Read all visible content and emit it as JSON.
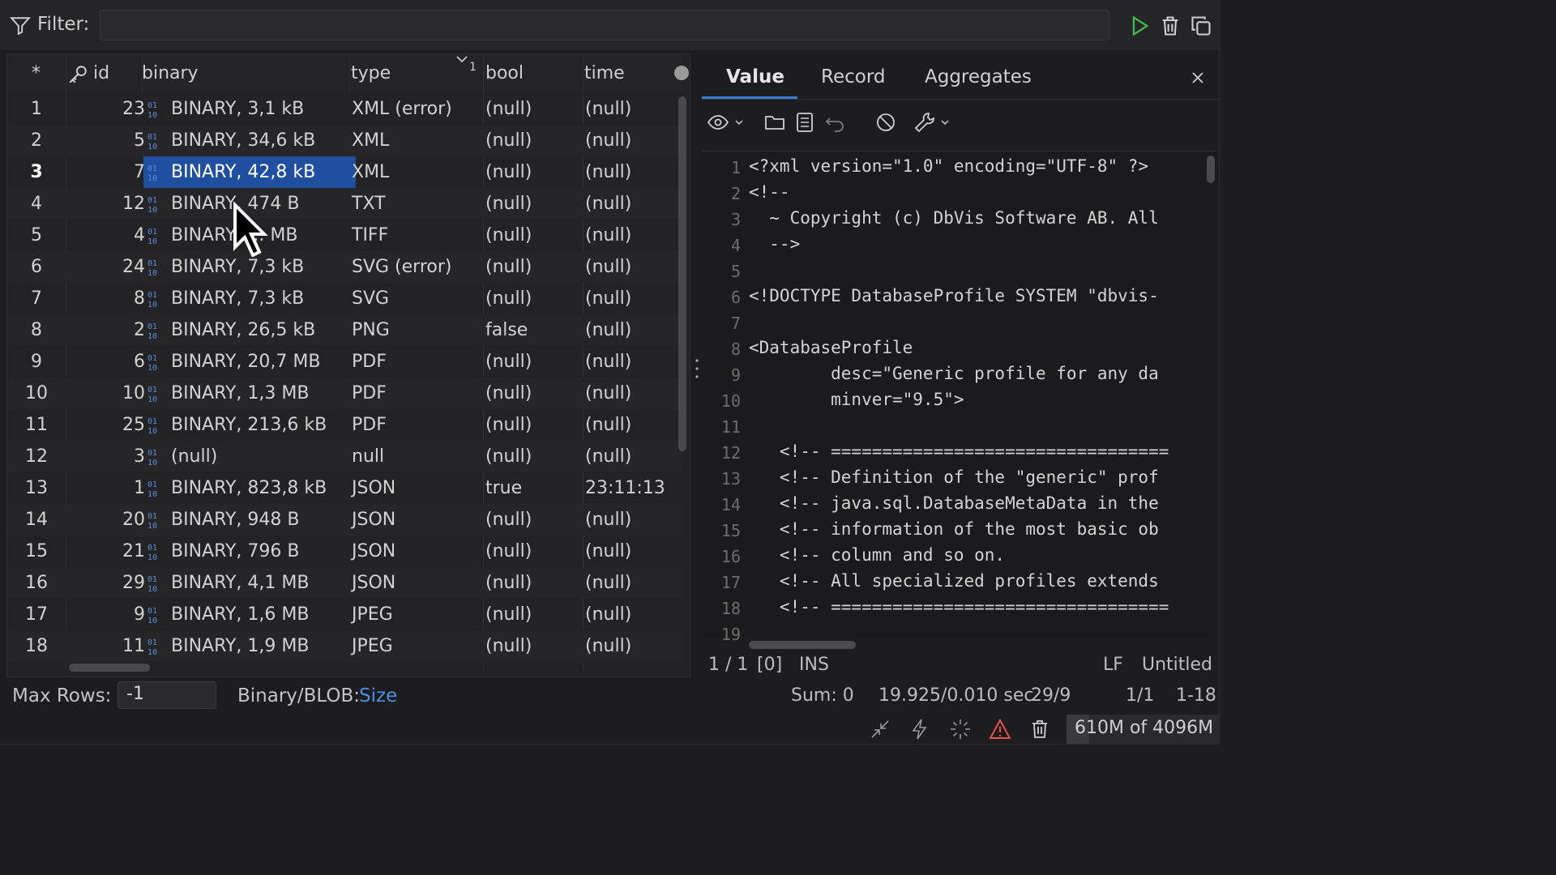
{
  "filter": {
    "label": "Filter:",
    "value": ""
  },
  "grid": {
    "columns": {
      "rownum": "*",
      "id": "id",
      "binary": "binary",
      "type": "type",
      "sort_index": "1",
      "bool": "bool",
      "time": "time"
    },
    "rows": [
      {
        "n": "1",
        "id": "23",
        "binary": "BINARY, 3,1 kB",
        "type": "XML (error)",
        "bool": "(null)",
        "time": "(null)"
      },
      {
        "n": "2",
        "id": "5",
        "binary": "BINARY, 34,6 kB",
        "type": "XML",
        "bool": "(null)",
        "time": "(null)"
      },
      {
        "n": "3",
        "id": "7",
        "binary": "BINARY, 42,8 kB",
        "type": "XML",
        "bool": "(null)",
        "time": "(null)"
      },
      {
        "n": "4",
        "id": "12",
        "binary": "BINARY, 474 B",
        "type": "TXT",
        "bool": "(null)",
        "time": "(null)"
      },
      {
        "n": "5",
        "id": "4",
        "binary": "BINARY, ... MB",
        "type": "TIFF",
        "bool": "(null)",
        "time": "(null)"
      },
      {
        "n": "6",
        "id": "24",
        "binary": "BINARY, 7,3 kB",
        "type": "SVG (error)",
        "bool": "(null)",
        "time": "(null)"
      },
      {
        "n": "7",
        "id": "8",
        "binary": "BINARY, 7,3 kB",
        "type": "SVG",
        "bool": "(null)",
        "time": "(null)"
      },
      {
        "n": "8",
        "id": "2",
        "binary": "BINARY, 26,5 kB",
        "type": "PNG",
        "bool": "false",
        "time": "(null)"
      },
      {
        "n": "9",
        "id": "6",
        "binary": "BINARY, 20,7 MB",
        "type": "PDF",
        "bool": "(null)",
        "time": "(null)"
      },
      {
        "n": "10",
        "id": "10",
        "binary": "BINARY, 1,3 MB",
        "type": "PDF",
        "bool": "(null)",
        "time": "(null)"
      },
      {
        "n": "11",
        "id": "25",
        "binary": "BINARY, 213,6 kB",
        "type": "PDF",
        "bool": "(null)",
        "time": "(null)"
      },
      {
        "n": "12",
        "id": "3",
        "binary": "(null)",
        "type": "null",
        "bool": "(null)",
        "time": "(null)"
      },
      {
        "n": "13",
        "id": "1",
        "binary": "BINARY, 823,8 kB",
        "type": "JSON",
        "bool": "true",
        "time": "23:11:13"
      },
      {
        "n": "14",
        "id": "20",
        "binary": "BINARY, 948 B",
        "type": "JSON",
        "bool": "(null)",
        "time": "(null)"
      },
      {
        "n": "15",
        "id": "21",
        "binary": "BINARY, 796 B",
        "type": "JSON",
        "bool": "(null)",
        "time": "(null)"
      },
      {
        "n": "16",
        "id": "29",
        "binary": "BINARY, 4,1 MB",
        "type": "JSON",
        "bool": "(null)",
        "time": "(null)"
      },
      {
        "n": "17",
        "id": "9",
        "binary": "BINARY, 1,6 MB",
        "type": "JPEG",
        "bool": "(null)",
        "time": "(null)"
      },
      {
        "n": "18",
        "id": "11",
        "binary": "BINARY, 1,9 MB",
        "type": "JPEG",
        "bool": "(null)",
        "time": "(null)"
      }
    ],
    "selected_row": "3"
  },
  "bottom_left": {
    "maxrows_label": "Max Rows:",
    "maxrows_value": "-1",
    "blob_label": "Binary/BLOB:",
    "blob_link": "Size"
  },
  "tabs": [
    {
      "label": "Value"
    },
    {
      "label": "Record"
    },
    {
      "label": "Aggregates"
    }
  ],
  "editor": {
    "lines": [
      {
        "n": "1",
        "text": "<?xml version=\"1.0\" encoding=\"UTF-8\" ?>"
      },
      {
        "n": "2",
        "text": "<!--"
      },
      {
        "n": "3",
        "text": "  ~ Copyright (c) DbVis Software AB. All"
      },
      {
        "n": "4",
        "text": "  -->"
      },
      {
        "n": "5",
        "text": ""
      },
      {
        "n": "6",
        "text": "<!DOCTYPE DatabaseProfile SYSTEM \"dbvis-"
      },
      {
        "n": "7",
        "text": ""
      },
      {
        "n": "8",
        "text": "<DatabaseProfile"
      },
      {
        "n": "9",
        "text": "        desc=\"Generic profile for any da"
      },
      {
        "n": "10",
        "text": "        minver=\"9.5\">"
      },
      {
        "n": "11",
        "text": ""
      },
      {
        "n": "12",
        "text": "   <!-- ================================="
      },
      {
        "n": "13",
        "text": "   <!-- Definition of the \"generic\" prof"
      },
      {
        "n": "14",
        "text": "   <!-- java.sql.DatabaseMetaData in the"
      },
      {
        "n": "15",
        "text": "   <!-- information of the most basic ob"
      },
      {
        "n": "16",
        "text": "   <!-- column and so on."
      },
      {
        "n": "17",
        "text": "   <!-- All specialized profiles extends"
      },
      {
        "n": "18",
        "text": "   <!-- ================================="
      },
      {
        "n": "19",
        "text": ""
      }
    ]
  },
  "editor_status": {
    "position": "1 / 1",
    "selection": "[0]",
    "mode": "INS",
    "line_ending": "LF",
    "doc_name": "Untitled"
  },
  "status": {
    "sum": "Sum: 0",
    "timing": "19.925/0.010 sec",
    "ratio": "29/9",
    "page": "1/1",
    "range": "1-18",
    "memory": "610M of 4096M"
  },
  "colors": {
    "accent": "#3d7ad6",
    "selection": "#1f4f9e",
    "run": "#3fb950",
    "warning": "#e5534b",
    "link": "#4a90e2"
  }
}
